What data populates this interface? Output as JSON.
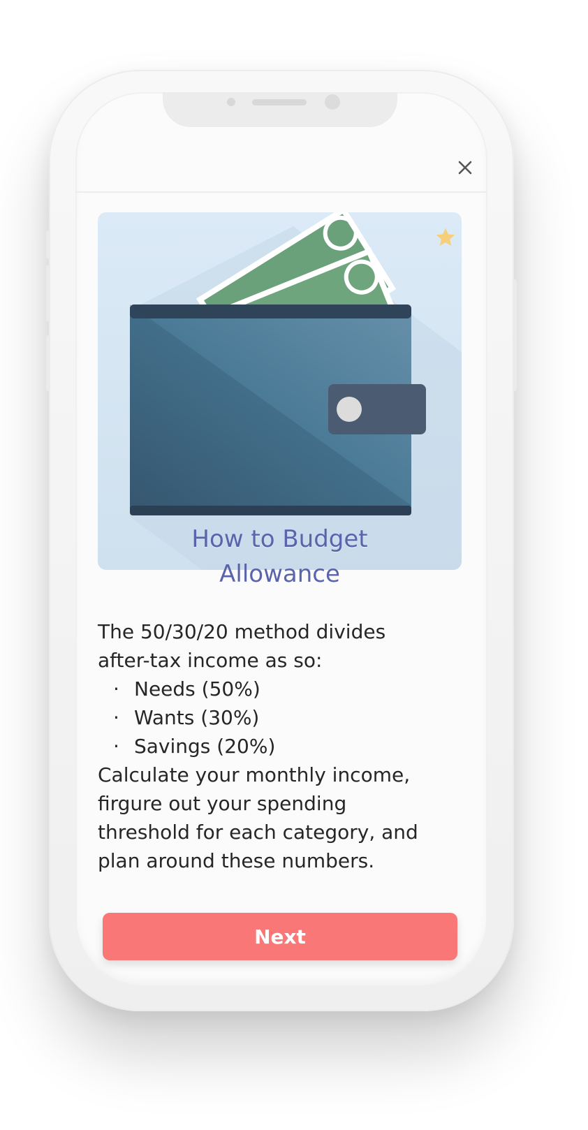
{
  "header": {
    "close_icon": "close-icon"
  },
  "hero": {
    "illustration": "wallet-with-money-illustration",
    "badge_icon": "star-icon",
    "colors": {
      "background": "#dbeaf6",
      "wallet": "#4a7a96",
      "money": "#6aa07a",
      "star": "#f7cf7a"
    }
  },
  "content": {
    "title_line1": "How to Budget",
    "title_line2": "Allowance",
    "intro_line1": "The 50/30/20 method divides",
    "intro_line2": "after-tax income as so:",
    "bullets": [
      "Needs (50%)",
      "Wants (30%)",
      "Savings (20%)"
    ],
    "outro_line1": "Calculate your monthly income,",
    "outro_line2": "firgure out your spending",
    "outro_line3": "threshold for each category, and",
    "outro_line4": "plan around these numbers."
  },
  "actions": {
    "next_label": "Next",
    "next_color": "#fa7778"
  }
}
